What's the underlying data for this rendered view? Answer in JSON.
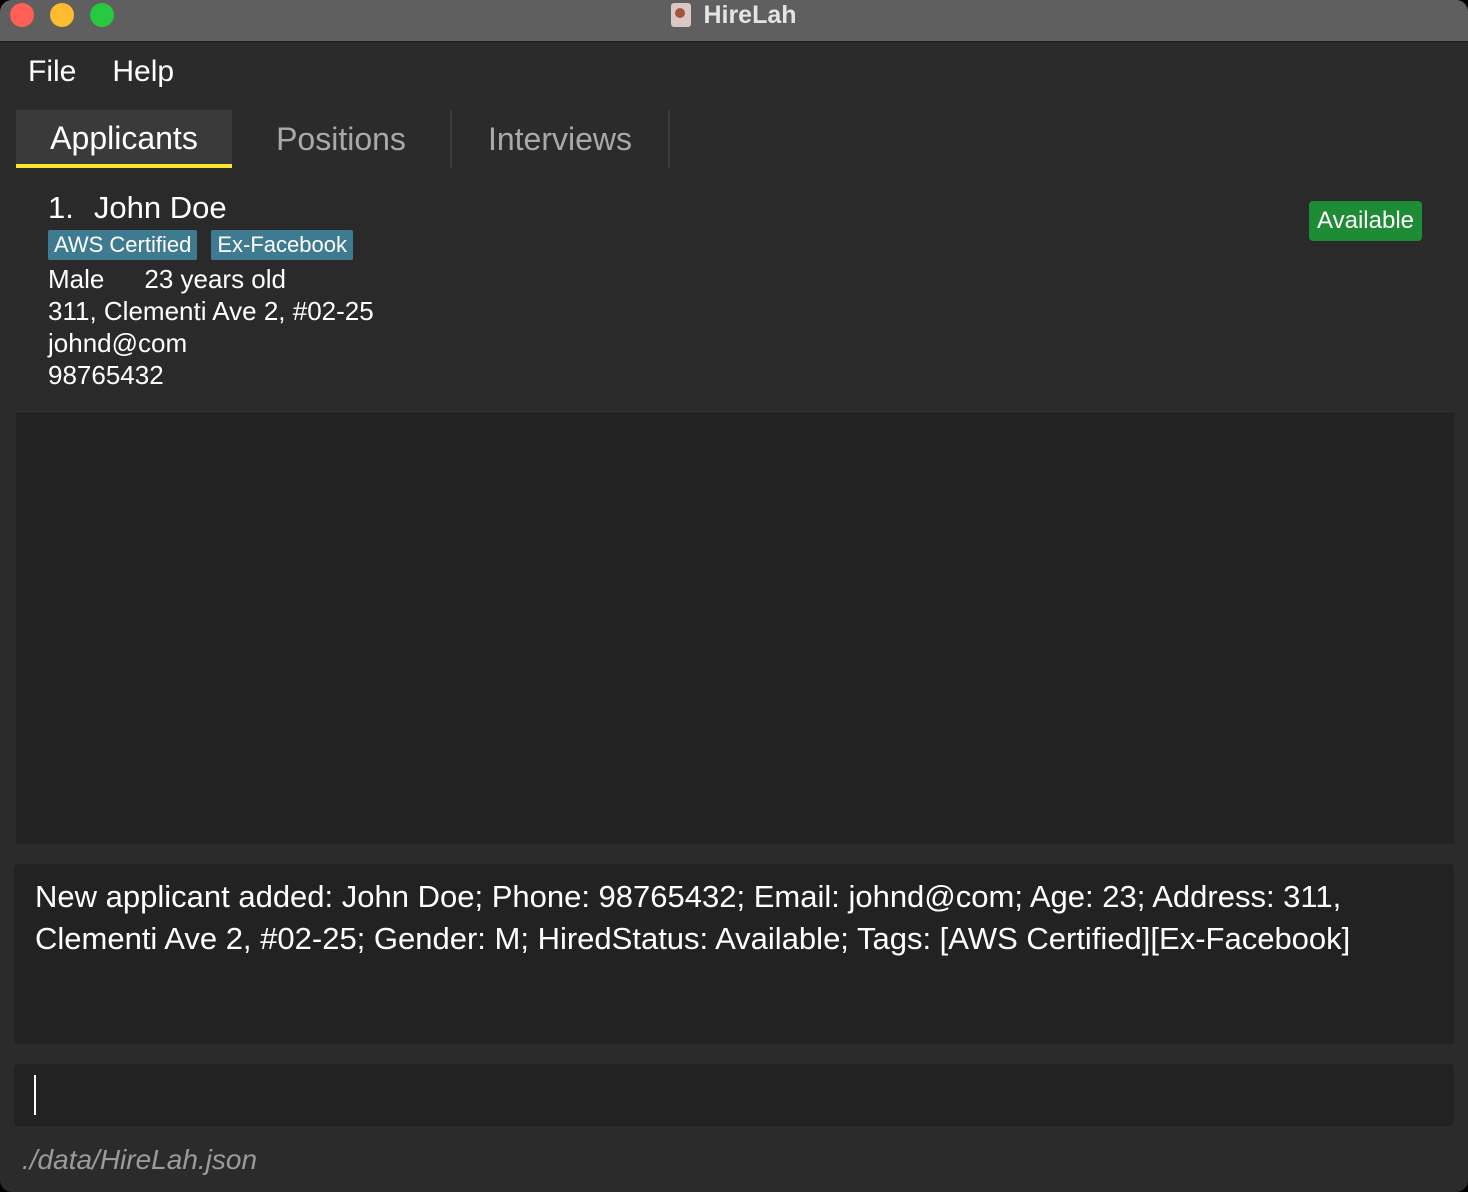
{
  "window": {
    "title": "HireLah"
  },
  "menu": {
    "items": [
      "File",
      "Help"
    ]
  },
  "tabs": [
    {
      "label": "Applicants",
      "active": true
    },
    {
      "label": "Positions",
      "active": false
    },
    {
      "label": "Interviews",
      "active": false
    }
  ],
  "applicants": [
    {
      "index": "1.",
      "name": "John Doe",
      "tags": [
        "AWS Certified",
        "Ex-Facebook"
      ],
      "gender": "Male",
      "age": "23 years old",
      "address": "311, Clementi Ave 2, #02-25",
      "email": "johnd@com",
      "phone": "98765432",
      "status": "Available"
    }
  ],
  "result": {
    "text": "New applicant added: John Doe; Phone: 98765432; Email: johnd@com; Age: 23; Address: 311, Clementi Ave 2, #02-25; Gender: M; HiredStatus: Available; Tags: [AWS Certified][Ex-Facebook]"
  },
  "command": {
    "value": "",
    "placeholder": ""
  },
  "status_bar": {
    "file_path": "./data/HireLah.json"
  },
  "colors": {
    "active_tab_underline": "#f7e62b",
    "tag_background": "#3e7b91",
    "status_available": "#1d8c34",
    "window_background": "#2b2b2b"
  }
}
